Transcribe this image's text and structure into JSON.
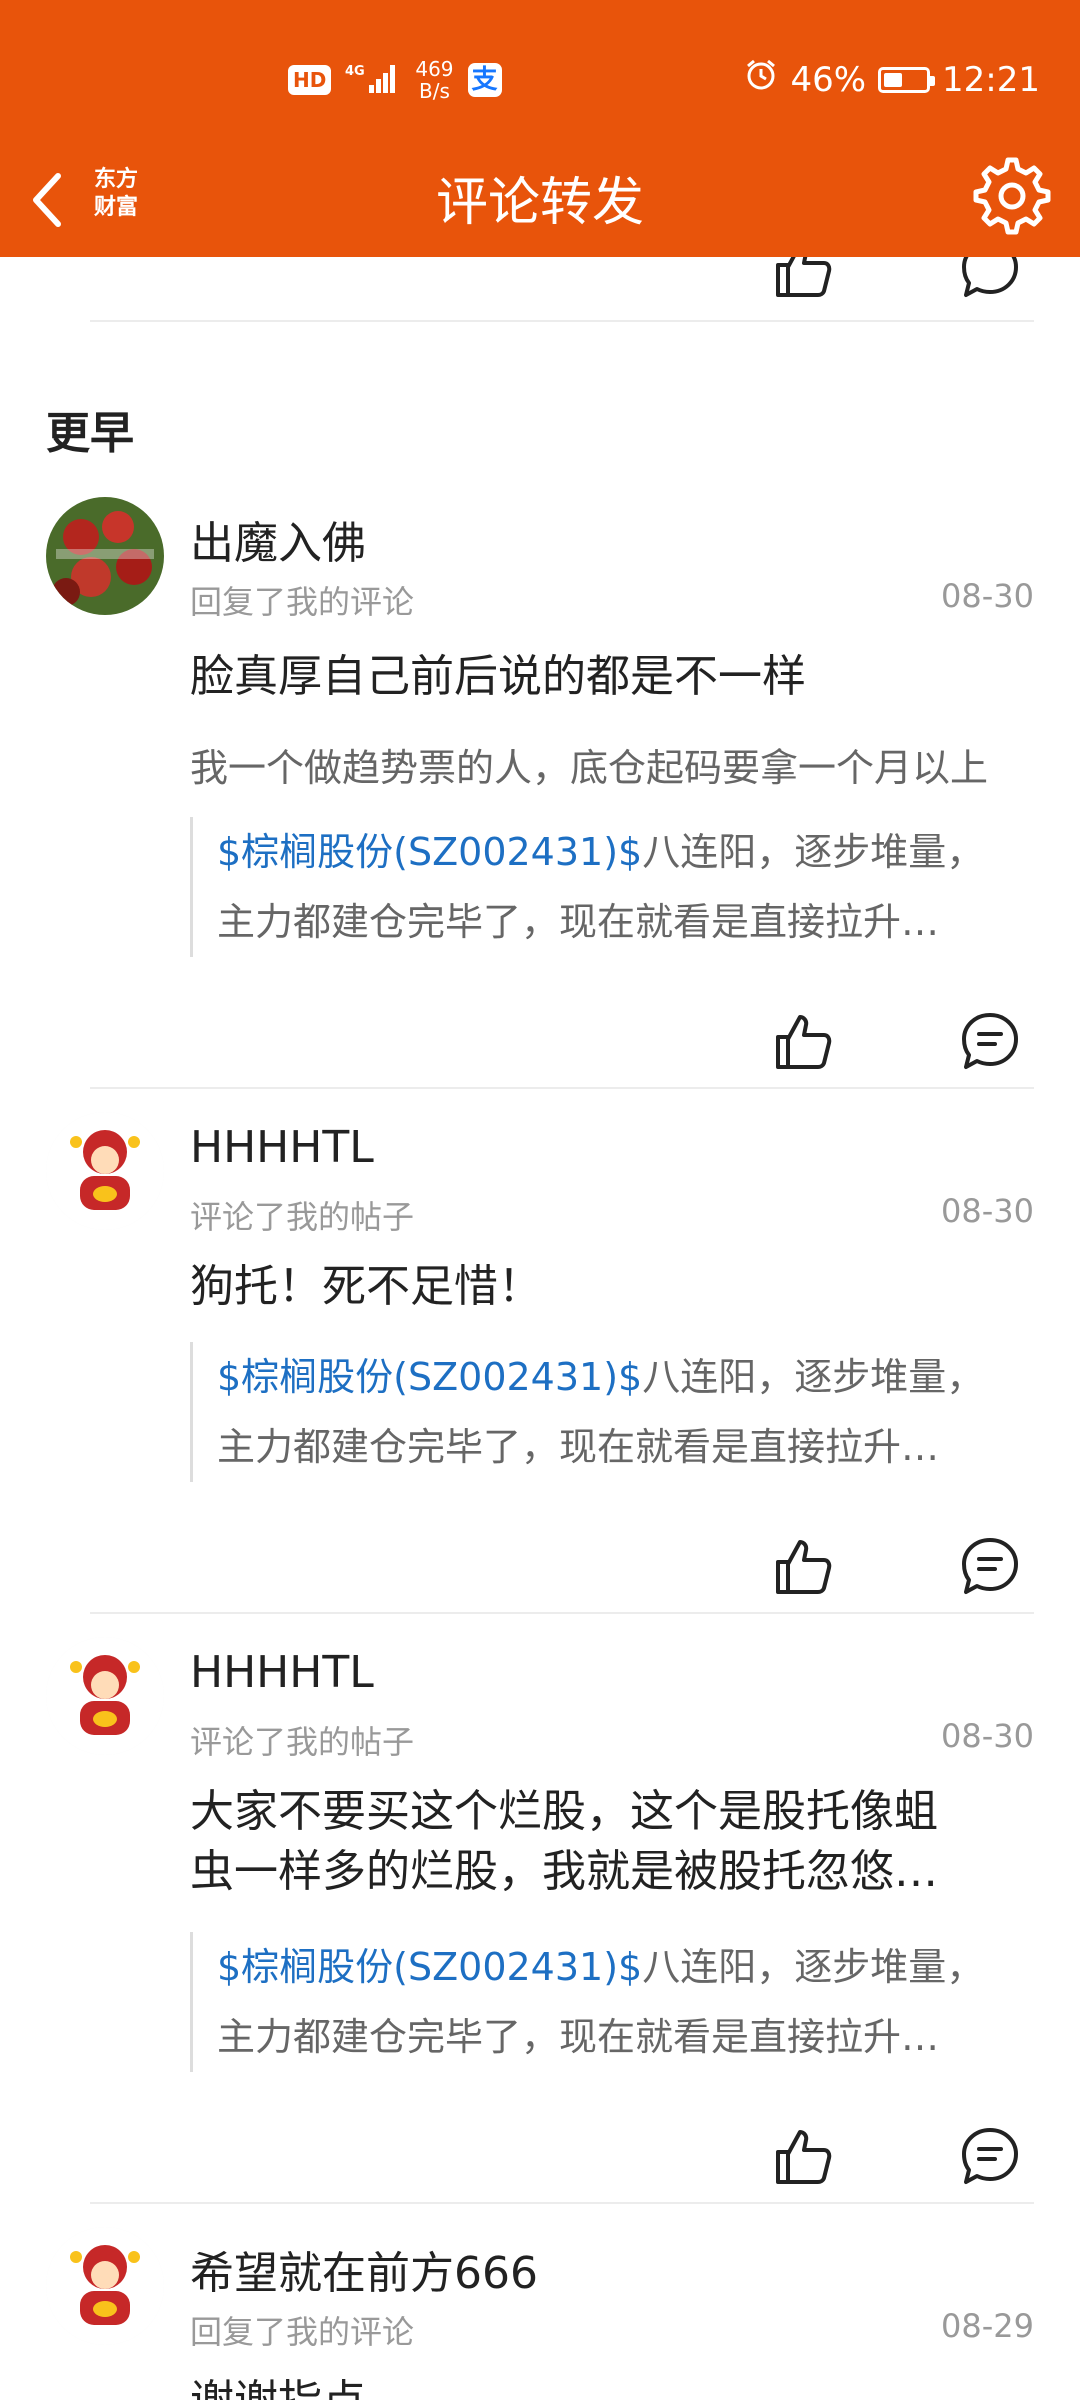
{
  "status_bar": {
    "hd": "HD",
    "signal": "4G",
    "net_speed_value": "469",
    "net_speed_unit": "B/s",
    "alipay_icon": "支",
    "battery": "46%",
    "battery_level": 0.46,
    "time": "12:21"
  },
  "nav": {
    "logo_line1": "东方",
    "logo_line2": "财富",
    "title": "评论转发"
  },
  "section": {
    "title": "更早"
  },
  "items": [
    {
      "username": "出魔入佛",
      "action": "回复了我的评论",
      "date": "08-30",
      "comment": "脸真厚自己前后说的都是不一样",
      "reply_preview": "我一个做趋势票的人，底仓起码要拿一个月以上",
      "quote_stock": "$棕榈股份(SZ002431)$",
      "quote_rest": "八连阳，逐步堆量，",
      "quote_line2": "主力都建仓完毕了，现在就看是直接拉升…"
    },
    {
      "username": "HHHHTL",
      "action": "评论了我的帖子",
      "date": "08-30",
      "comment": "狗托！死不足惜！",
      "quote_stock": "$棕榈股份(SZ002431)$",
      "quote_rest": "八连阳，逐步堆量，",
      "quote_line2": "主力都建仓完毕了，现在就看是直接拉升…"
    },
    {
      "username": "HHHHTL",
      "action": "评论了我的帖子",
      "date": "08-30",
      "comment_line1": "大家不要买这个烂股，这个是股托像蛆",
      "comment_line2": "虫一样多的烂股，我就是被股托忽悠…",
      "quote_stock": "$棕榈股份(SZ002431)$",
      "quote_rest": "八连阳，逐步堆量，",
      "quote_line2": "主力都建仓完毕了，现在就看是直接拉升…"
    },
    {
      "username": "希望就在前方666",
      "action": "回复了我的评论",
      "date": "08-29",
      "comment": "谢谢指点"
    }
  ],
  "colors": {
    "brand": "#e8540b",
    "stock_link": "#1d6fc3"
  },
  "icons": [
    "back-arrow-icon",
    "settings-gear-icon",
    "thumbs-up-icon",
    "comment-bubble-icon"
  ]
}
